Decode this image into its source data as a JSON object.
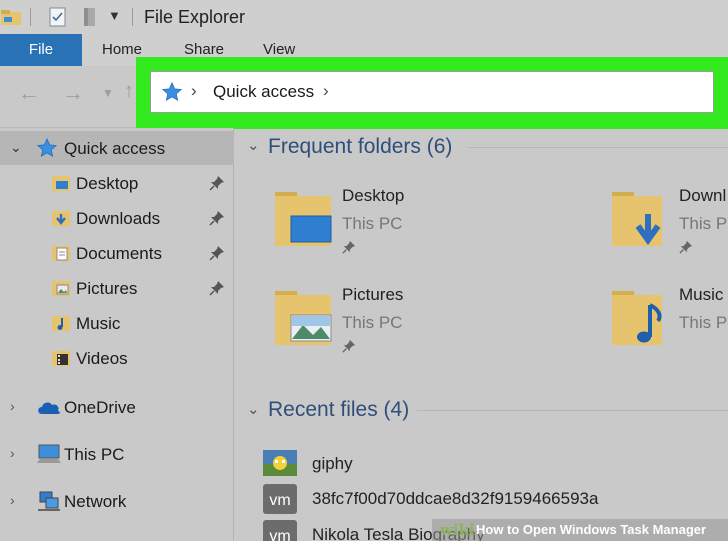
{
  "window": {
    "title": "File Explorer"
  },
  "ribbon": {
    "tabs": [
      "File",
      "Home",
      "Share",
      "View"
    ]
  },
  "address": {
    "path": "Quick access"
  },
  "sidebar": {
    "quick_access": "Quick access",
    "items": [
      "Desktop",
      "Downloads",
      "Documents",
      "Pictures",
      "Music",
      "Videos"
    ],
    "onedrive": "OneDrive",
    "this_pc": "This PC",
    "network": "Network"
  },
  "main": {
    "frequent_header": "Frequent folders (6)",
    "folders": [
      {
        "name": "Desktop",
        "location": "This PC"
      },
      {
        "name": "Downl",
        "location": "This PC"
      },
      {
        "name": "Pictures",
        "location": "This PC"
      },
      {
        "name": "Music",
        "location": "This PC"
      }
    ],
    "recent_header": "Recent files (4)",
    "recent": [
      "giphy",
      "38fc7f00d70ddcae8d32f9159466593a",
      "Nikola Tesla Biography"
    ],
    "vm_label": "vm"
  },
  "watermark": {
    "brand": "wiki",
    "text": "How to Open Windows Task Manager"
  },
  "colors": {
    "file_tab": "#2a72b6",
    "highlight": "#33ea1e",
    "header_blue": "#2f4e7a",
    "folder_yellow": "#e6c46e"
  }
}
